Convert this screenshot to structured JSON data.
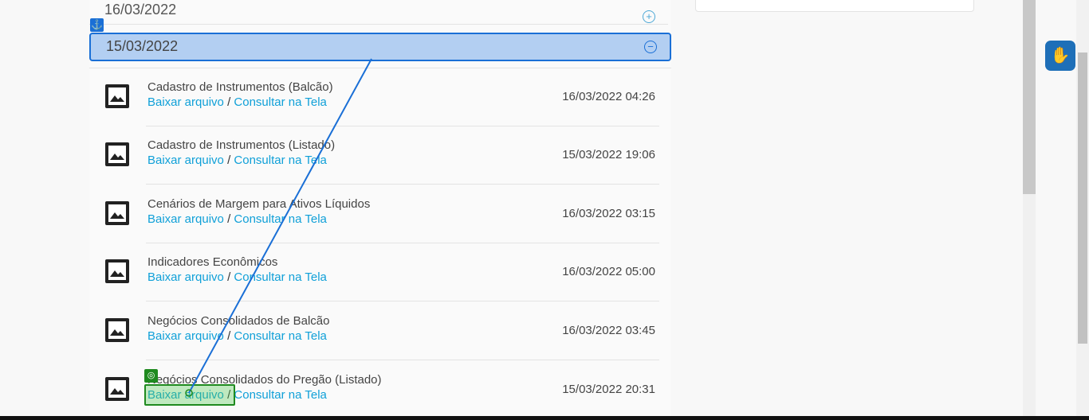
{
  "dates": {
    "previous": "16/03/2022",
    "active": "15/03/2022"
  },
  "icons": {
    "expand": "plus-circle-icon",
    "collapse": "minus-circle-icon",
    "file": "image-icon",
    "accessibility": "sign-language-icon",
    "anchor": "anchor-icon"
  },
  "link_separator": "/",
  "items": [
    {
      "title": "Cadastro de Instrumentos (Balcão)",
      "download": "Baixar arquivo",
      "view": "Consultar na Tela",
      "datetime": "16/03/2022 04:26"
    },
    {
      "title": "Cadastro de Instrumentos (Listado)",
      "download": "Baixar arquivo",
      "view": "Consultar na Tela",
      "datetime": "15/03/2022 19:06"
    },
    {
      "title": "Cenários de Margem para Ativos Líquidos",
      "download": "Baixar arquivo",
      "view": "Consultar na Tela",
      "datetime": "16/03/2022 03:15"
    },
    {
      "title": "Indicadores Econômicos",
      "download": "Baixar arquivo",
      "view": "Consultar na Tela",
      "datetime": "16/03/2022 05:00"
    },
    {
      "title": "Negócios Consolidados de Balcão",
      "download": "Baixar arquivo",
      "view": "Consultar na Tela",
      "datetime": "16/03/2022 03:45"
    },
    {
      "title": "Negócios Consolidados do Pregão (Listado)",
      "download": "Baixar arquivo",
      "view": "Consultar na Tela",
      "datetime": "15/03/2022 20:31"
    }
  ],
  "colors": {
    "link": "#10a0d8",
    "active_row_bg": "#b3cff2",
    "active_row_border": "#1a6fd6",
    "highlight": "#1f8a1f"
  }
}
